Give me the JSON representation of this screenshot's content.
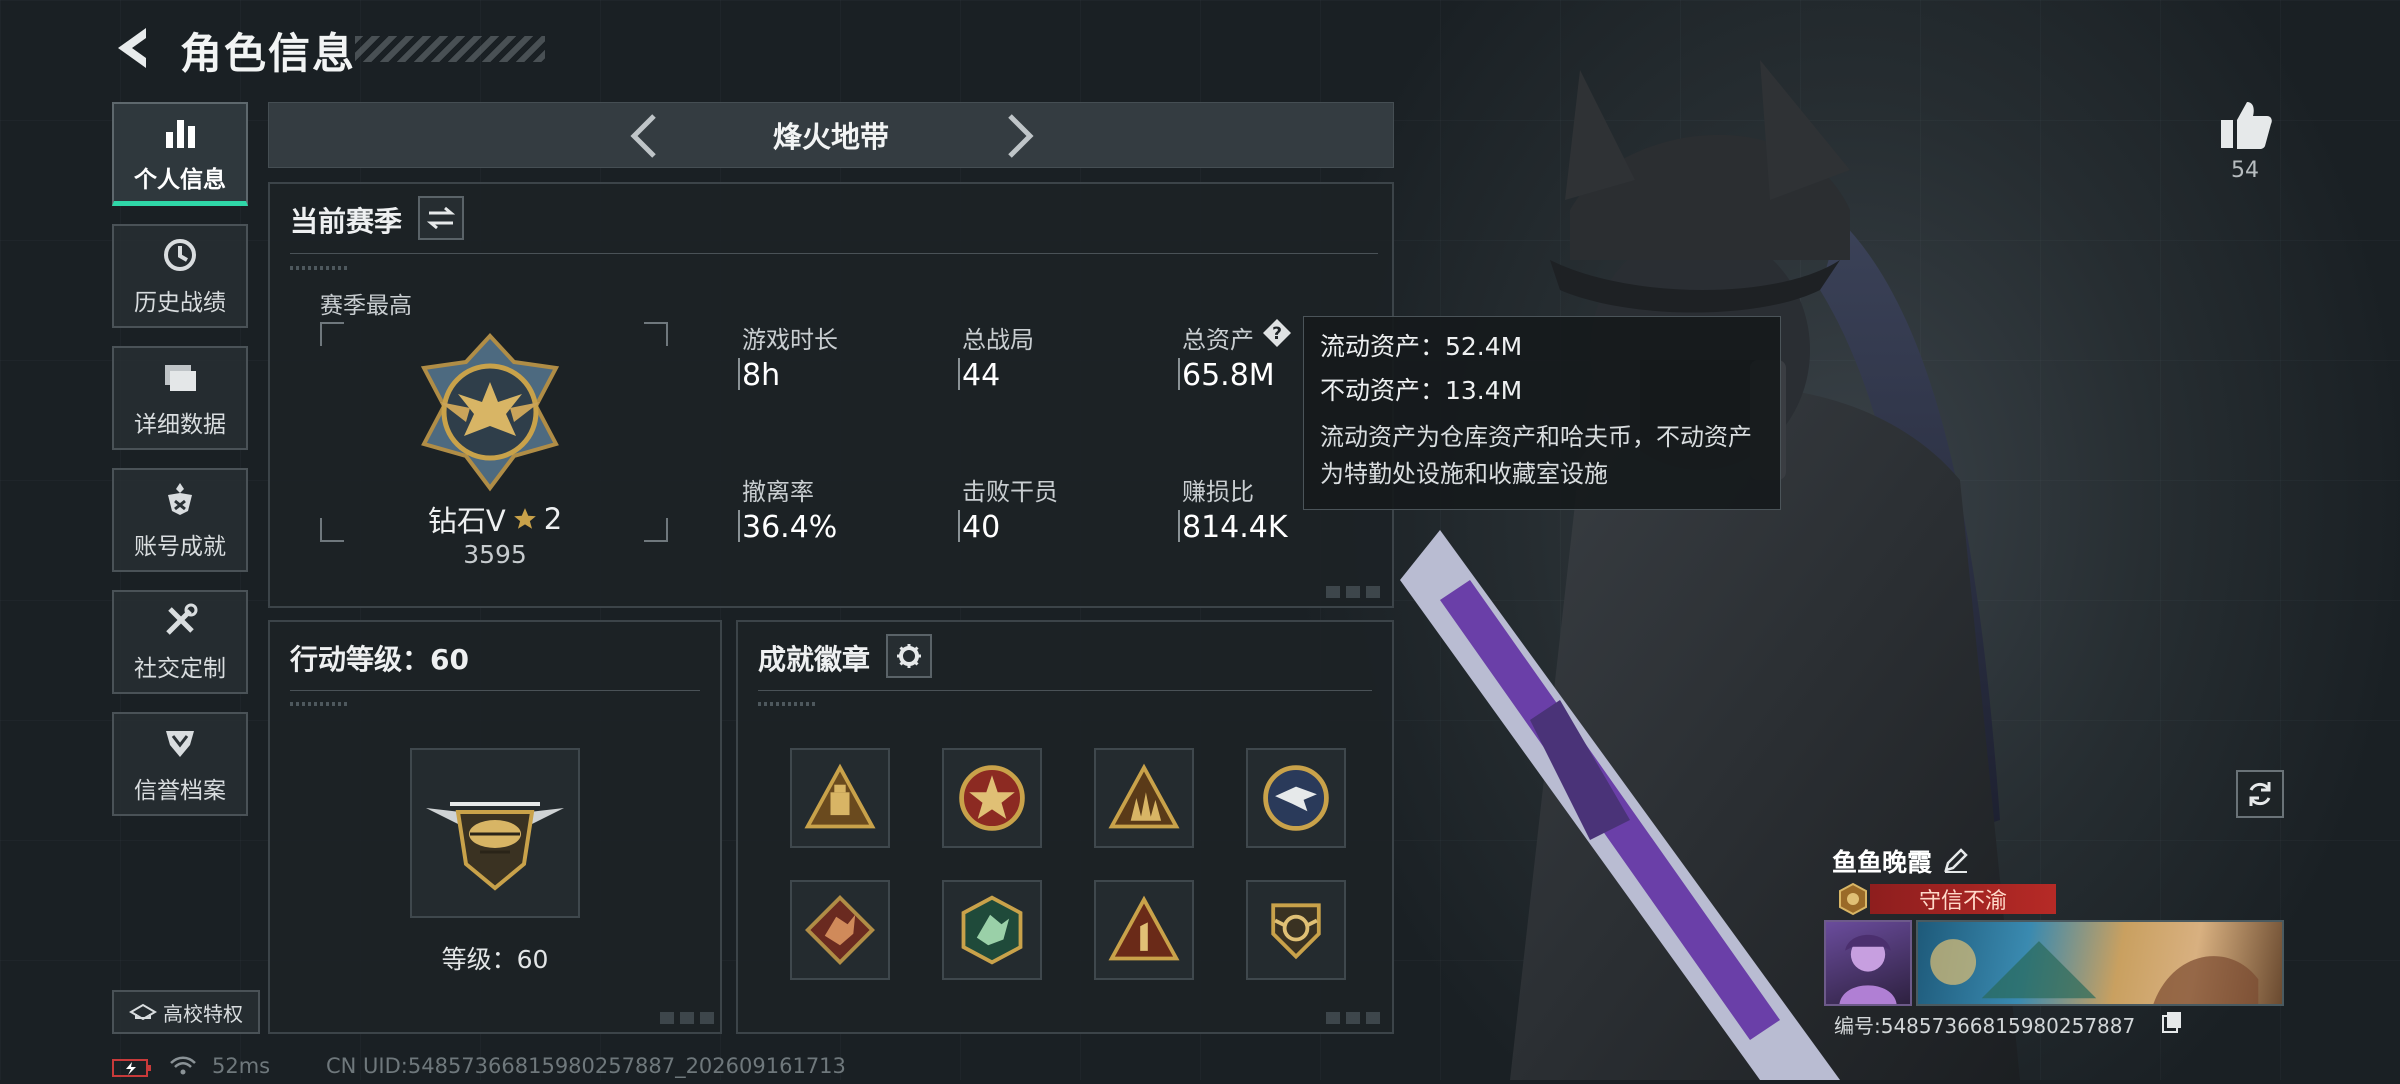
{
  "header": {
    "title": "角色信息"
  },
  "sidebar": {
    "items": [
      {
        "label": "个人信息",
        "icon": "bar-chart-icon",
        "active": true
      },
      {
        "label": "历史战绩",
        "icon": "history-clock-icon"
      },
      {
        "label": "详细数据",
        "icon": "folders-icon"
      },
      {
        "label": "账号成就",
        "icon": "achievement-icon"
      },
      {
        "label": "社交定制",
        "icon": "tools-icon"
      },
      {
        "label": "信誉档案",
        "icon": "reputation-emblem-icon"
      }
    ],
    "campus_label": "高校特权"
  },
  "mode": {
    "title": "烽火地带"
  },
  "season": {
    "title": "当前赛季",
    "best_label": "赛季最高",
    "rank_name": "钻石V",
    "rank_stars": "2",
    "rank_score": "3595",
    "stats": [
      {
        "label": "游戏时长",
        "value": "8h"
      },
      {
        "label": "总战局",
        "value": "44"
      },
      {
        "label": "总资产",
        "value": "65.8M"
      },
      {
        "label": "撤离率",
        "value": "36.4%"
      },
      {
        "label": "击败干员",
        "value": "40"
      },
      {
        "label": "赚损比",
        "value": "814.4K"
      }
    ]
  },
  "tooltip": {
    "liquid": "流动资产：52.4M",
    "fixed": "不动资产：13.4M",
    "desc_line1": "流动资产为仓库资产和哈夫币，不动资产",
    "desc_line2": "为特勤处设施和收藏室设施"
  },
  "level": {
    "title": "行动等级：60",
    "caption": "等级：60"
  },
  "badges": {
    "title": "成就徽章",
    "items": [
      "lantern-badge-icon",
      "star-wheel-badge-icon",
      "soldiers-badge-icon",
      "eagle-badge-icon",
      "dragon-badge-icon",
      "dragon-hex-badge-icon",
      "number-one-badge-icon",
      "wings-badge-icon"
    ]
  },
  "profile": {
    "likes": "54",
    "name": "鱼鱼晚霞",
    "title_tag": "守信不渝",
    "id_line": "编号:54857366815980257887"
  },
  "status": {
    "ping": "52ms",
    "uid": "CN UID:54857366815980257887_202609161713"
  },
  "colors": {
    "accent": "#2fd7a8",
    "tag_red": "#b62a26",
    "gold": "#c9a24a"
  }
}
